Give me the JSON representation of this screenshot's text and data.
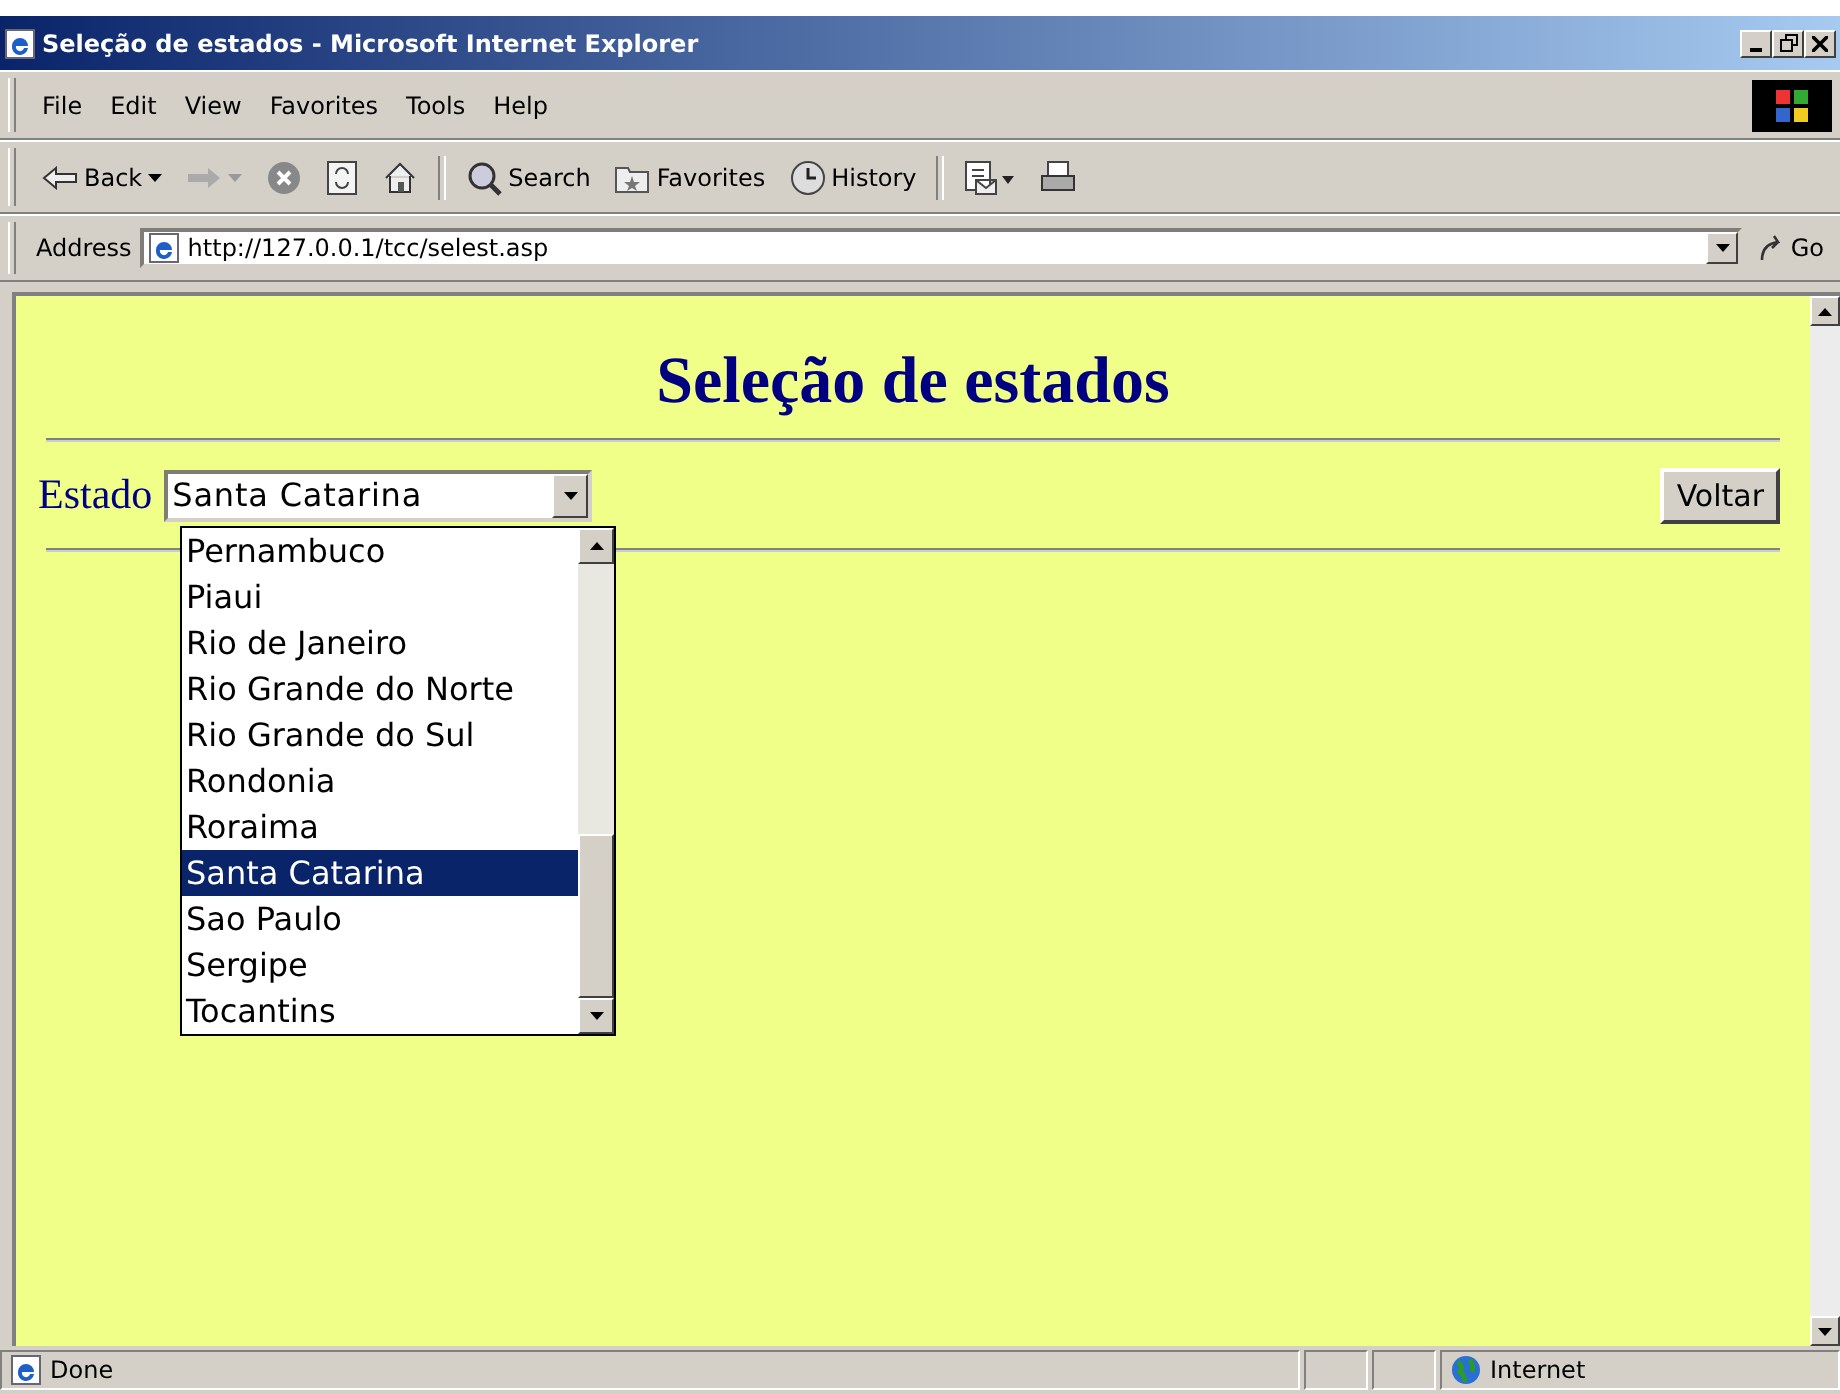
{
  "window": {
    "title": "Seleção de estados - Microsoft Internet Explorer"
  },
  "menu": [
    "File",
    "Edit",
    "View",
    "Favorites",
    "Tools",
    "Help"
  ],
  "toolbar": [
    {
      "kind": "back",
      "label": "Back"
    },
    {
      "kind": "forward"
    },
    {
      "kind": "stop"
    },
    {
      "kind": "refresh"
    },
    {
      "kind": "home"
    },
    {
      "kind": "search",
      "label": "Search"
    },
    {
      "kind": "favorites",
      "label": "Favorites"
    },
    {
      "kind": "history",
      "label": "History"
    },
    {
      "kind": "mail"
    },
    {
      "kind": "print"
    }
  ],
  "address": {
    "label": "Address",
    "value": "http://127.0.0.1/tcc/selest.asp",
    "go": "Go"
  },
  "page": {
    "heading": "Seleção de estados",
    "field_label": "Estado",
    "select_value": "Santa Catarina",
    "button": "Voltar",
    "options": [
      {
        "label": "Pernambuco",
        "selected": false
      },
      {
        "label": "Piaui",
        "selected": false
      },
      {
        "label": "Rio de Janeiro",
        "selected": false
      },
      {
        "label": "Rio Grande do Norte",
        "selected": false
      },
      {
        "label": "Rio Grande do Sul",
        "selected": false
      },
      {
        "label": "Rondonia",
        "selected": false
      },
      {
        "label": "Roraima",
        "selected": false
      },
      {
        "label": "Santa Catarina",
        "selected": true
      },
      {
        "label": "Sao Paulo",
        "selected": false
      },
      {
        "label": "Sergipe",
        "selected": false
      },
      {
        "label": "Tocantins",
        "selected": false
      }
    ]
  },
  "status_bar": {
    "text": "Done",
    "zone": "Internet"
  }
}
